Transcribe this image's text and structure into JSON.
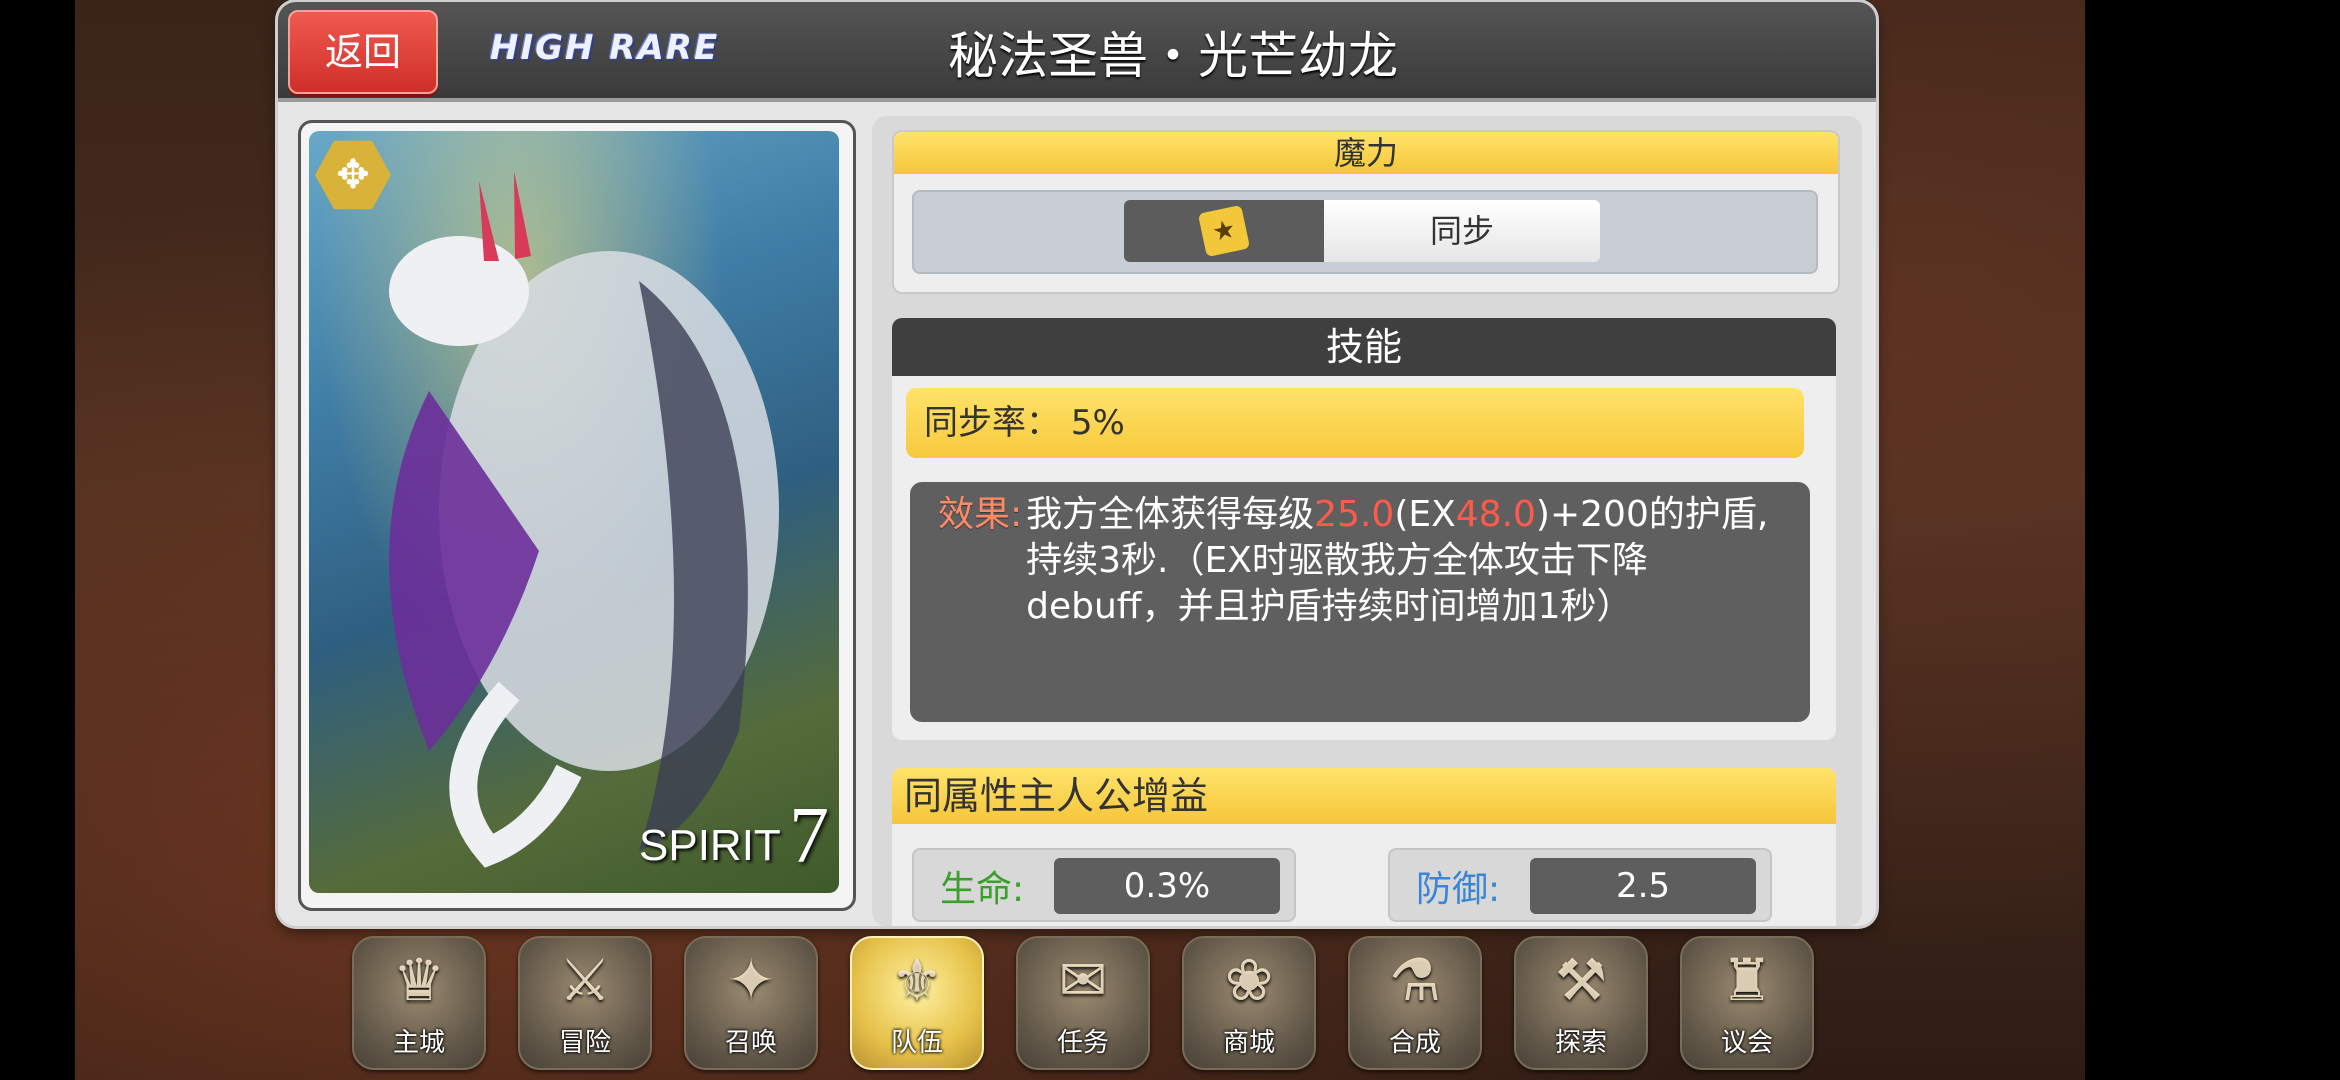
{
  "header": {
    "back_label": "返回",
    "rarity": "HIGH RARE",
    "card_name": "秘法圣兽・光芒幼龙"
  },
  "card": {
    "type_label": "SPIRIT",
    "cost": "7",
    "badge_icon": "spirit-emblem-icon"
  },
  "mana": {
    "title": "魔力",
    "upgrade_icon": "star-up-icon",
    "sync_label": "同步"
  },
  "skill": {
    "title": "技能",
    "sync_rate_label": "同步率：",
    "sync_rate_value": "5%",
    "effect_label": "效果:",
    "effect_part1": "我方全体获得每级",
    "effect_val1": "25.0",
    "effect_part2": "(EX",
    "effect_val2": "48.0",
    "effect_part3": ")+200的护盾,持续3秒.（EX时驱散我方全体攻击下降debuff，并且护盾持续时间增加1秒）"
  },
  "buff": {
    "title": "同属性主人公增益",
    "hp_label": "生命:",
    "hp_value": "0.3%",
    "def_label": "防御:",
    "def_value": "2.5"
  },
  "nav": {
    "items": [
      {
        "label": "主城",
        "icon": "castle-crown-icon"
      },
      {
        "label": "冒险",
        "icon": "crossed-swords-icon"
      },
      {
        "label": "召唤",
        "icon": "summon-card-icon"
      },
      {
        "label": "队伍",
        "icon": "winged-emblem-icon"
      },
      {
        "label": "任务",
        "icon": "quest-book-icon"
      },
      {
        "label": "商城",
        "icon": "shop-tree-icon"
      },
      {
        "label": "合成",
        "icon": "alchemy-icon"
      },
      {
        "label": "探索",
        "icon": "explore-tools-icon"
      },
      {
        "label": "议会",
        "icon": "council-crest-icon"
      }
    ],
    "active_index": 3
  },
  "colors": {
    "accent_yellow": "#f5c63a",
    "back_red": "#e0443c",
    "highlight_red": "#ff5a4a",
    "hp_green": "#3aa02a",
    "def_blue": "#3a86d6"
  }
}
